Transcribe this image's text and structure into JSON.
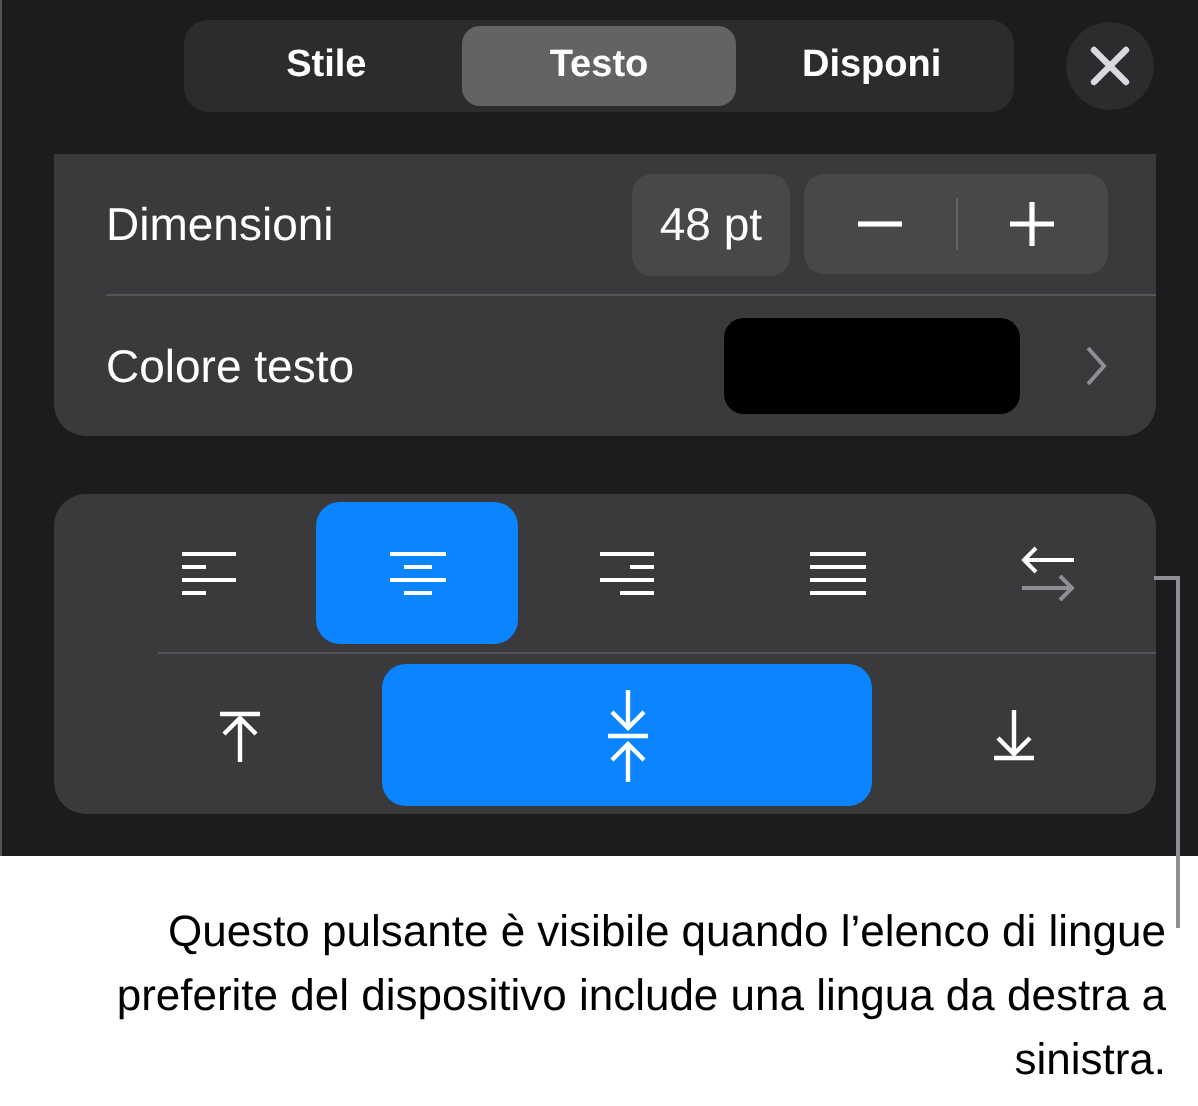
{
  "tabs": [
    {
      "label": "Stile",
      "selected": false
    },
    {
      "label": "Testo",
      "selected": true
    },
    {
      "label": "Disponi",
      "selected": false
    }
  ],
  "size_row": {
    "label": "Dimensioni",
    "value": "48 pt"
  },
  "color_row": {
    "label": "Colore testo",
    "color": "#000000"
  },
  "horizontal_alignment": [
    {
      "kind": "left",
      "selected": false
    },
    {
      "kind": "center",
      "selected": true
    },
    {
      "kind": "right",
      "selected": false
    },
    {
      "kind": "justify",
      "selected": false
    },
    {
      "kind": "direction",
      "selected": false
    }
  ],
  "vertical_alignment": [
    {
      "kind": "top",
      "selected": false
    },
    {
      "kind": "middle",
      "selected": true
    },
    {
      "kind": "bottom",
      "selected": false
    }
  ],
  "callout": "Questo pulsante è visibile quando l’elenco di lingue preferite del dispositivo include una lingua da destra a sinistra."
}
